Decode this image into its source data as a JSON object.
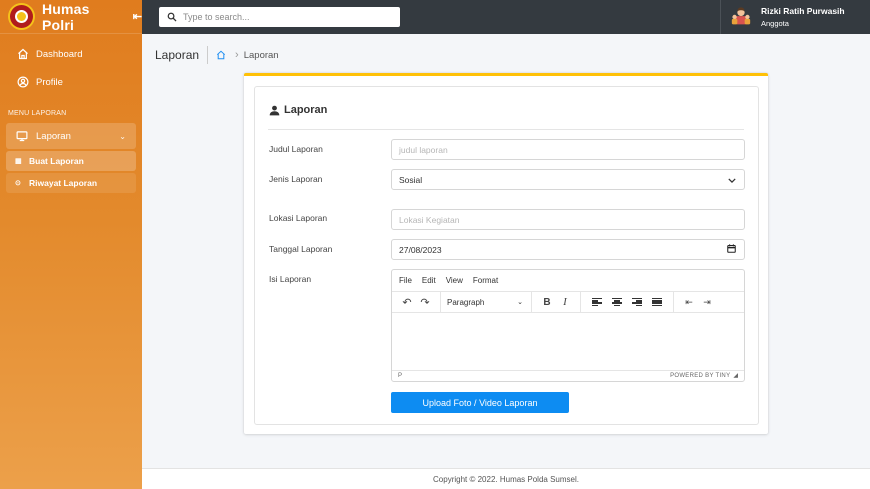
{
  "app": {
    "name": "Humas Polri"
  },
  "sidebar": {
    "items": [
      {
        "label": "Dashboard",
        "icon": "home-icon"
      },
      {
        "label": "Profile",
        "icon": "user-circle-icon"
      }
    ],
    "section_label": "MENU LAPORAN",
    "group": {
      "label": "Laporan",
      "icon": "monitor-icon"
    },
    "sub_items": [
      {
        "label": "Buat Laporan",
        "icon": "calendar-icon"
      },
      {
        "label": "Riwayat Laporan",
        "icon": "history-icon"
      }
    ]
  },
  "topbar": {
    "search_placeholder": "Type to search...",
    "user": {
      "name": "Rizki Ratih Purwasih",
      "role": "Anggota"
    }
  },
  "page": {
    "title": "Laporan",
    "breadcrumb": [
      "Laporan"
    ]
  },
  "form": {
    "title": "Laporan",
    "fields": {
      "judul": {
        "label": "Judul Laporan",
        "placeholder": "judul laporan"
      },
      "jenis": {
        "label": "Jenis Laporan",
        "value": "Sosial"
      },
      "lokasi": {
        "label": "Lokasi Laporan",
        "placeholder": "Lokasi Kegiatan"
      },
      "tanggal": {
        "label": "Tanggal Laporan",
        "value": "27/08/2023"
      },
      "isi": {
        "label": "Isi Laporan"
      }
    },
    "editor": {
      "menu": [
        "File",
        "Edit",
        "View",
        "Format"
      ],
      "block_format": "Paragraph",
      "status_path": "P",
      "powered": "POWERED BY TINY"
    },
    "upload_label": "Upload Foto / Video Laporan"
  },
  "footer": {
    "text": "Copyright © 2022. Humas Polda Sumsel."
  },
  "colors": {
    "sidebar": "#e38a2c",
    "topbar": "#343a40",
    "accent": "#ffc107",
    "button": "#0d8cf2"
  }
}
